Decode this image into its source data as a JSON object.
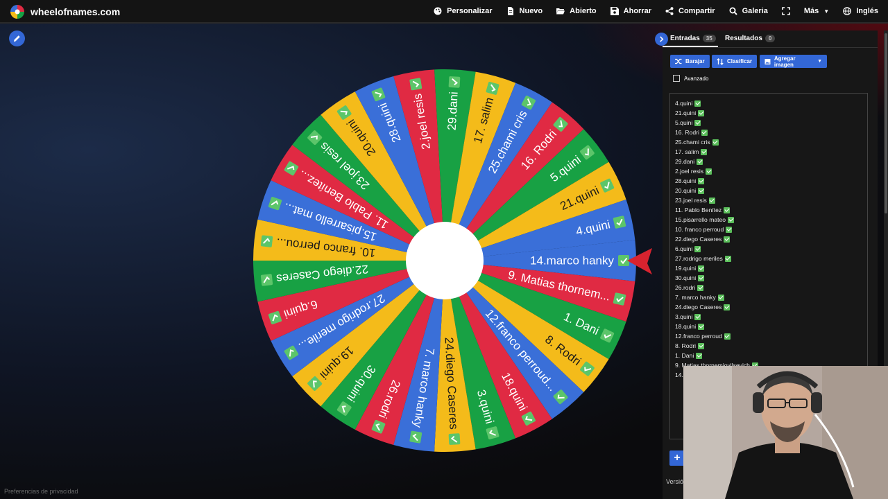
{
  "site": {
    "name": "wheelofnames.com"
  },
  "nav": {
    "customize": "Personalizar",
    "new": "Nuevo",
    "open": "Abierto",
    "save": "Ahorrar",
    "share": "Compartir",
    "gallery": "Galeria",
    "more": "Más",
    "language": "Inglés"
  },
  "wheel": {
    "colors": [
      "#3a6fd8",
      "#e02a43",
      "#18a144",
      "#f4bb1a"
    ],
    "segments": [
      "14.marco hanky",
      "9. Matias thornem...",
      "1. Dani",
      "8. Rodri",
      "12.franco perroud...",
      "18.quini",
      "3.quini",
      "24.diego Caseres",
      "7. marco hanky",
      "26.rodri",
      "30.quini",
      "19.quini",
      "27.rodrigo merile...",
      "6.quini",
      "22.diego Caseres",
      "10. franco perrou...",
      "15.pisarrello mat...",
      "11. Pablo Benítez...",
      "23.joel resis",
      "20.quini",
      "28.quini",
      "2.joel resis",
      "29.dani",
      "17. salim",
      "25.chami cris",
      "16. Rodri",
      "5.quini",
      "21.quini",
      "4.quini"
    ]
  },
  "panel": {
    "tabs": [
      {
        "label": "Entradas",
        "count": "35"
      },
      {
        "label": "Resultados",
        "count": "0"
      }
    ],
    "buttons": {
      "shuffle": "Barajar",
      "sort": "Clasificar",
      "add_image": "Agregar imagen"
    },
    "advanced": "Avanzado",
    "entries": [
      "4.quini",
      "21.quini",
      "5.quini",
      "16. Rodri",
      "25.chami cris",
      "17. salim",
      "29.dani",
      "2.joel resis",
      "28.quini",
      "20.quini",
      "23.joel resis",
      "11. Pablo Benítez",
      "15.pisarrello mateo",
      "10. franco perroud",
      "22.diego Caseres",
      "6.quini",
      "27.rodrigo meriles",
      "19.quini",
      "30.quini",
      "26.rodri",
      "7. marco hanky",
      "24.diego Caseres",
      "3.quini",
      "18.quini",
      "12.franco perroud",
      "8. Rodri",
      "1. Dani",
      "9. Matias thornemiovilsevich",
      "14."
    ],
    "add_symbol": "+",
    "version": "Versió"
  },
  "footer": {
    "privacy": "Preferencias de privacidad"
  }
}
